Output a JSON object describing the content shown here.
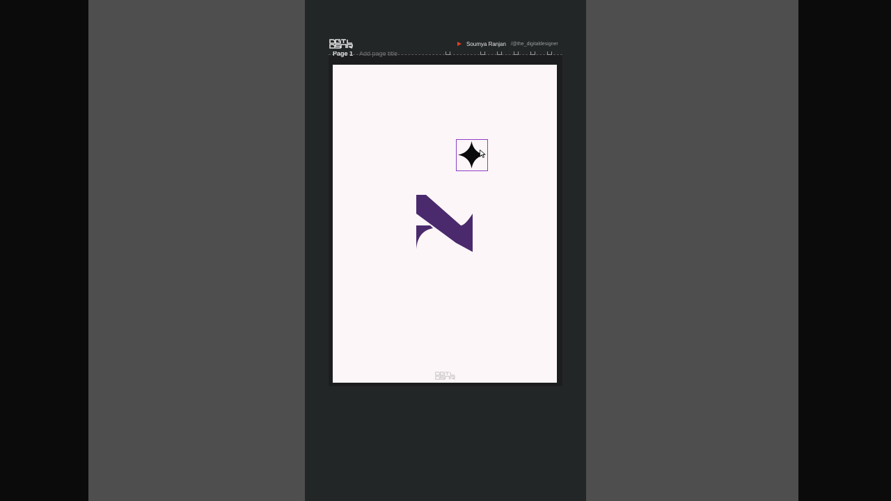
{
  "channel": {
    "author_name": "Soumya Ranjan",
    "author_handle": "/@the_digitaldesigner"
  },
  "editor": {
    "page_label": "Page 1",
    "page_title_placeholder": "Add page title"
  },
  "colors": {
    "brand_purple": "#4a2a6d",
    "selection": "#8e3cc7",
    "page_background": "#fcf6f8",
    "accent_red": "#e2431c"
  },
  "icons": {
    "logo": "dgtl-dsgnr-logo-icon",
    "star": "four-point-star-icon",
    "cursor": "mouse-cursor-icon",
    "play": "play-icon"
  }
}
